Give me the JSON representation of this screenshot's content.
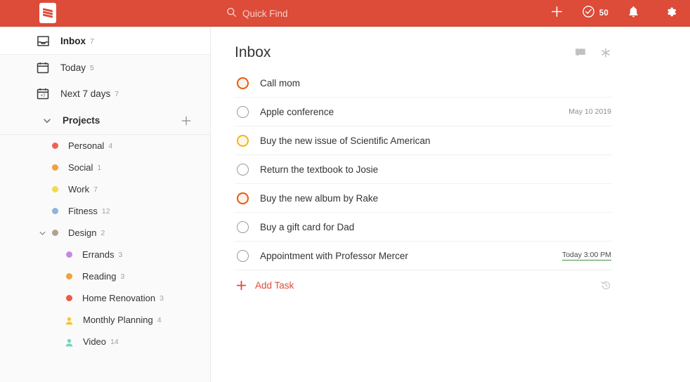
{
  "app": {
    "brand_color": "#dd4b39",
    "logo_name": "todoist-logo"
  },
  "topbar": {
    "quick_find_label": "Quick Find",
    "quick_find_icon": "search-icon",
    "add_icon": "plus-icon",
    "karma_icon": "check-circle-icon",
    "karma_value": "50",
    "notifications_icon": "bell-icon",
    "settings_icon": "gear-icon"
  },
  "sidebar": {
    "nav": [
      {
        "label": "Inbox",
        "count": "7",
        "icon": "inbox-icon",
        "selected": true
      },
      {
        "label": "Today",
        "count": "5",
        "icon": "calendar-icon",
        "selected": false
      },
      {
        "label": "Next 7 days",
        "count": "7",
        "icon": "calendar-7-icon",
        "selected": false
      }
    ],
    "section": {
      "title": "Projects",
      "collapse_icon": "chevron-down-icon",
      "add_icon": "plus-icon"
    },
    "projects": [
      {
        "label": "Personal",
        "count": "4",
        "color": "#eb6457",
        "marker": "dot",
        "indent": false,
        "chevron": false
      },
      {
        "label": "Social",
        "count": "1",
        "color": "#f0a23c",
        "marker": "dot",
        "indent": false,
        "chevron": false
      },
      {
        "label": "Work",
        "count": "7",
        "color": "#f5d94e",
        "marker": "dot",
        "indent": false,
        "chevron": false
      },
      {
        "label": "Fitness",
        "count": "12",
        "color": "#8fb3dc",
        "marker": "dot",
        "indent": false,
        "chevron": false
      },
      {
        "label": "Design",
        "count": "2",
        "color": "#b3a18f",
        "marker": "dot",
        "indent": false,
        "chevron": true
      },
      {
        "label": "Errands",
        "count": "3",
        "color": "#c58ade",
        "marker": "dot",
        "indent": true,
        "chevron": false
      },
      {
        "label": "Reading",
        "count": "3",
        "color": "#f0a23c",
        "marker": "dot",
        "indent": true,
        "chevron": false
      },
      {
        "label": "Home Renovation",
        "count": "3",
        "color": "#eb5b46",
        "marker": "dot",
        "indent": true,
        "chevron": false
      },
      {
        "label": "Monthly Planning",
        "count": "4",
        "color": "#f5c531",
        "marker": "person",
        "indent": true,
        "chevron": false
      },
      {
        "label": "Video",
        "count": "14",
        "color": "#6fd7bf",
        "marker": "person",
        "indent": true,
        "chevron": false
      }
    ]
  },
  "main": {
    "title": "Inbox",
    "comment_icon": "comment-icon",
    "options_icon": "sort-options-icon",
    "tasks": [
      {
        "name": "Call mom",
        "due": "",
        "priority": "p2",
        "due_today": false
      },
      {
        "name": "Apple conference",
        "due": "May 10 2019",
        "priority": "none",
        "due_today": false
      },
      {
        "name": "Buy the new issue of Scientific American",
        "due": "",
        "priority": "p3",
        "due_today": false
      },
      {
        "name": "Return the textbook to Josie",
        "due": "",
        "priority": "none",
        "due_today": false
      },
      {
        "name": "Buy the new album by Rake",
        "due": "",
        "priority": "p2",
        "due_today": false
      },
      {
        "name": "Buy a gift card for Dad",
        "due": "",
        "priority": "none",
        "due_today": false
      },
      {
        "name": "Appointment with Professor Mercer",
        "due": "Today 3:00 PM",
        "priority": "none",
        "due_today": true
      }
    ],
    "add_task_label": "Add Task",
    "add_task_icon": "plus-icon",
    "history_icon": "history-clock-icon"
  },
  "colors": {
    "brand": "#dd4b39",
    "priority_2": "#e8590c",
    "priority_3": "#f2b51b",
    "today_green": "#3f9142"
  }
}
